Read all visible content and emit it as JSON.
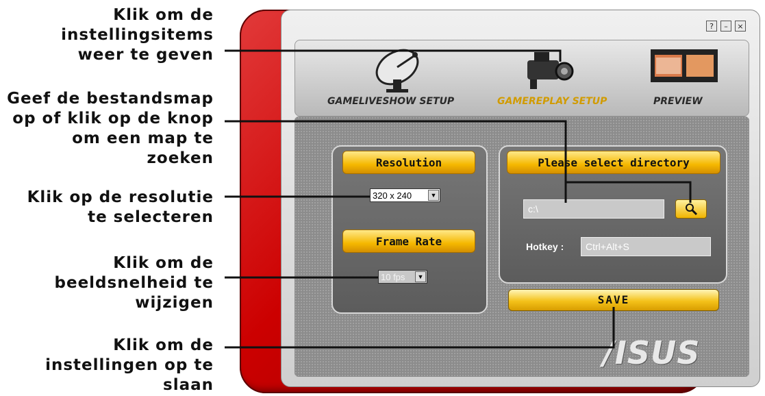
{
  "callouts": {
    "show_items": "Klik om de\ninstellingsitems\nweer te geven",
    "directory": "Geef de bestandsmap\nop of klik op de knop\nom een map te zoeken",
    "resolution": "Klik op de resolutie\nte selecteren",
    "framerate": "Klik om de\nbeeldsnelheid te\nwijzigen",
    "save": "Klik om de\ninstellingen op te\nslaan"
  },
  "window": {
    "buttons": [
      "?",
      "–",
      "×"
    ],
    "colors": {
      "frame_red": "#cc0000",
      "accent_yellow": "#f5b800",
      "panel_gray": "#666666"
    }
  },
  "toolbar": {
    "items": [
      {
        "label": "GAMELIVESHOW SETUP",
        "icon": "satellite-dish-icon",
        "color": "#2a2a2a"
      },
      {
        "label": "GAMEREPLAY SETUP",
        "icon": "video-camera-icon",
        "color": "#d19b00"
      },
      {
        "label": "PREVIEW",
        "icon": "film-strip-icon",
        "color": "#2a2a2a"
      }
    ]
  },
  "resolution": {
    "header": "Resolution",
    "value": "320 x 240"
  },
  "framerate": {
    "header": "Frame Rate",
    "value": "10 fps"
  },
  "directory": {
    "header": "Please select directory",
    "path": "c:\\",
    "search_icon": "magnifier-icon"
  },
  "hotkey": {
    "label": "Hotkey :",
    "value": "Ctrl+Alt+S"
  },
  "save": {
    "label": "SAVE"
  },
  "brand": {
    "logo": "/ISUS"
  }
}
